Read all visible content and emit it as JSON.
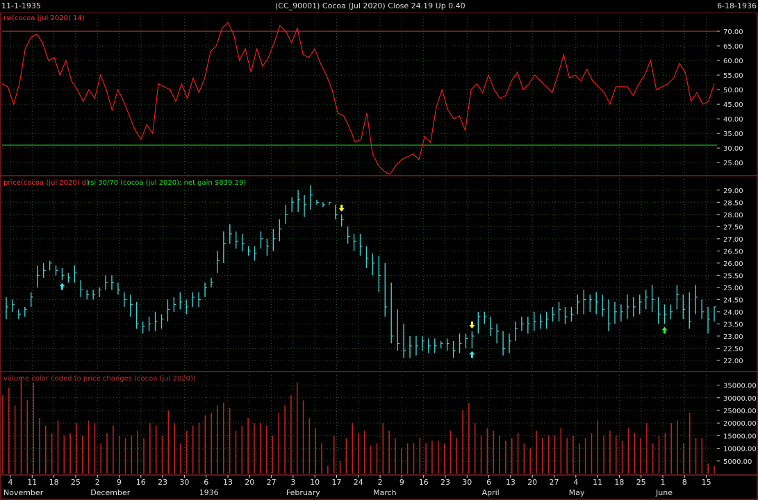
{
  "header": {
    "start_date": "11-1-1935",
    "title": "(CC_90001)  Cocoa (Jul 2020)   Close 24.19   Up 0.40",
    "end_date": "6-18-1936"
  },
  "colors": {
    "rsi": "#ff2020",
    "price": "#40d0d0",
    "volume": "#c02020",
    "grid": "#2e5a2e",
    "border": "#c03030",
    "level70": "#e04040",
    "level30": "#20e020",
    "buy": "#40e0e0",
    "sell": "#ffff20",
    "green_arrow": "#20ff20"
  },
  "chart_data": [
    {
      "type": "line",
      "title": "rsi(cocoa (jul 2020) 14)",
      "ylim": [
        21,
        75
      ],
      "yticks": [
        "70.00",
        "65.00",
        "60.00",
        "55.00",
        "50.00",
        "45.00",
        "40.00",
        "35.00",
        "30.00",
        "25.00"
      ],
      "yticks_values": [
        70,
        65,
        60,
        55,
        50,
        45,
        40,
        35,
        30,
        25
      ],
      "levels": [
        70,
        31
      ],
      "values": [
        52,
        51,
        45,
        52,
        64,
        68,
        69,
        66,
        60,
        61,
        55,
        60,
        53,
        50,
        46,
        50,
        47,
        55,
        50,
        43,
        50,
        46,
        41,
        36,
        33,
        38,
        35,
        52,
        51,
        50,
        46,
        52,
        47,
        54,
        49,
        54,
        63,
        65,
        71,
        73,
        69,
        60,
        64,
        56,
        64,
        58,
        61,
        66,
        72,
        70,
        66,
        71,
        62,
        61,
        64,
        59,
        55,
        50,
        42,
        41,
        37,
        32,
        33,
        42,
        28,
        24,
        22,
        21,
        24,
        26,
        27,
        28,
        26,
        34,
        32,
        44,
        50,
        43,
        40,
        41,
        36,
        50,
        52,
        49,
        55,
        50,
        47,
        48,
        53,
        56,
        50,
        52,
        55,
        53,
        51,
        49,
        55,
        62,
        54,
        55,
        53,
        57,
        53,
        51,
        49,
        45,
        51,
        51,
        51,
        48,
        52,
        55,
        60,
        50,
        51,
        52,
        54,
        59,
        56,
        46,
        49,
        45,
        46,
        52
      ],
      "xaxis": "shared"
    },
    {
      "type": "bar",
      "subtype": "ohlc",
      "title": "price(cocoa (jul 2020) d)",
      "subtitle": "rsi 30/70 (cocoa (jul 2020): net gain $839.29)",
      "ylim": [
        21.6,
        29.45
      ],
      "yticks": [
        "29.00",
        "28.50",
        "28.00",
        "27.50",
        "27.00",
        "26.50",
        "26.00",
        "25.50",
        "25.00",
        "24.50",
        "24.00",
        "23.50",
        "23.00",
        "22.50",
        "22.00"
      ],
      "yticks_values": [
        29,
        28.5,
        28,
        27.5,
        27,
        26.5,
        26,
        25.5,
        25,
        24.5,
        24,
        23.5,
        23,
        22.5,
        22
      ],
      "highs": [
        24.6,
        24.5,
        24.1,
        24.2,
        24.8,
        25.9,
        26.0,
        26.1,
        25.9,
        25.8,
        25.6,
        25.9,
        25.3,
        24.9,
        24.9,
        25.0,
        25.5,
        25.5,
        25.2,
        24.8,
        24.7,
        24.4,
        23.6,
        23.8,
        24.0,
        23.9,
        24.5,
        24.6,
        24.8,
        24.5,
        24.8,
        24.8,
        25.2,
        25.4,
        26.5,
        27.3,
        27.6,
        27.3,
        27.2,
        26.7,
        26.7,
        27.3,
        27.0,
        27.4,
        27.8,
        28.4,
        28.7,
        29.0,
        28.8,
        29.2,
        28.6,
        28.5,
        28.5,
        28.4,
        28.0,
        27.5,
        27.2,
        27.2,
        26.7,
        26.4,
        26.3,
        26.0,
        25.2,
        24.1,
        23.5,
        23.0,
        23.0,
        23.0,
        22.9,
        22.9,
        22.8,
        22.9,
        22.8,
        23.1,
        23.1,
        23.2,
        24.0,
        24.0,
        23.8,
        23.5,
        23.2,
        23.1,
        23.6,
        23.8,
        23.8,
        24.0,
        23.9,
        24.0,
        24.2,
        24.4,
        24.2,
        24.2,
        24.7,
        24.9,
        24.7,
        24.8,
        24.7,
        24.5,
        24.4,
        24.3,
        24.7,
        24.6,
        24.7,
        24.9,
        25.1,
        24.6,
        24.3,
        24.3,
        25.1,
        24.7,
        24.8,
        25.1,
        24.5,
        24.2,
        24.2
      ],
      "lows": [
        23.7,
        24.0,
        23.7,
        23.8,
        24.2,
        25.0,
        25.4,
        25.7,
        25.5,
        25.3,
        25.2,
        25.2,
        24.6,
        24.5,
        24.5,
        24.6,
        24.9,
        24.9,
        24.7,
        24.2,
        23.8,
        23.3,
        23.1,
        23.2,
        23.2,
        23.3,
        23.6,
        24.0,
        24.1,
        23.9,
        24.2,
        24.2,
        24.6,
        25.0,
        25.6,
        26.0,
        26.8,
        26.6,
        26.5,
        26.3,
        26.1,
        26.6,
        26.3,
        26.5,
        26.9,
        27.6,
        28.1,
        28.1,
        27.9,
        28.2,
        28.4,
        28.3,
        28.4,
        27.8,
        27.5,
        26.8,
        26.5,
        26.3,
        25.8,
        25.5,
        24.8,
        23.8,
        22.7,
        22.4,
        22.1,
        22.1,
        22.2,
        22.4,
        22.3,
        22.3,
        22.5,
        22.4,
        22.1,
        22.3,
        22.5,
        22.5,
        23.1,
        23.5,
        23.0,
        22.7,
        22.2,
        22.3,
        22.8,
        23.2,
        23.1,
        23.2,
        23.3,
        23.3,
        23.6,
        23.6,
        23.5,
        23.6,
        23.9,
        23.9,
        24.0,
        23.9,
        23.8,
        23.2,
        23.5,
        23.6,
        23.7,
        23.8,
        23.9,
        24.1,
        24.0,
        23.5,
        23.5,
        23.7,
        24.1,
        23.7,
        23.3,
        23.9,
        23.7,
        23.1,
        23.6
      ],
      "closes": [
        24.2,
        24.3,
        23.9,
        24.1,
        24.6,
        25.5,
        25.7,
        26.0,
        25.7,
        25.5,
        25.4,
        25.6,
        24.9,
        24.7,
        24.7,
        24.9,
        25.2,
        25.2,
        24.9,
        24.5,
        24.3,
        23.5,
        23.4,
        23.5,
        23.6,
        23.7,
        24.1,
        24.3,
        24.4,
        24.2,
        24.6,
        24.5,
        25.0,
        25.2,
        26.1,
        26.8,
        27.2,
        26.9,
        26.8,
        26.5,
        26.4,
        27.0,
        26.7,
        27.0,
        27.4,
        28.0,
        28.5,
        28.6,
        28.4,
        28.8,
        28.5,
        28.4,
        28.5,
        28.0,
        27.8,
        27.1,
        26.9,
        26.7,
        26.2,
        26.0,
        25.5,
        24.2,
        23.0,
        22.7,
        22.4,
        22.6,
        22.6,
        22.8,
        22.6,
        22.6,
        22.7,
        22.7,
        22.4,
        22.7,
        22.9,
        23.0,
        23.8,
        23.8,
        23.3,
        23.2,
        22.5,
        22.8,
        23.3,
        23.5,
        23.5,
        23.6,
        23.6,
        23.7,
        23.9,
        24.1,
        23.8,
        23.9,
        24.4,
        24.5,
        24.5,
        24.4,
        24.1,
        23.5,
        24.0,
        24.0,
        24.2,
        24.2,
        24.4,
        24.6,
        24.5,
        23.9,
        23.9,
        24.0,
        24.7,
        24.1,
        23.6,
        24.6,
        24.0,
        23.7,
        24.2
      ],
      "signals": [
        {
          "type": "buy",
          "index": 9
        },
        {
          "type": "sell",
          "index": 54
        },
        {
          "type": "sell",
          "index": 75
        },
        {
          "type": "buy",
          "index": 75
        },
        {
          "type": "buy",
          "index": 106
        }
      ],
      "xaxis": "shared"
    },
    {
      "type": "bar",
      "title": "volume color coded to price changes (cocoa (jul 2020))",
      "ylim": [
        0,
        39000
      ],
      "yticks": [
        "35000.00",
        "30000.00",
        "25000.00",
        "20000.00",
        "15000.00",
        "10000.00",
        "5000.00"
      ],
      "yticks_values": [
        35000,
        30000,
        25000,
        20000,
        15000,
        10000,
        5000
      ],
      "values": [
        31000,
        34000,
        27000,
        38000,
        29000,
        36000,
        22000,
        19000,
        16000,
        21000,
        15000,
        16000,
        20000,
        15000,
        21000,
        20000,
        12000,
        16000,
        19000,
        15000,
        14000,
        15000,
        17000,
        14000,
        20000,
        19000,
        15000,
        25000,
        20000,
        12000,
        17000,
        19000,
        20000,
        23000,
        24000,
        27000,
        28000,
        26000,
        17000,
        19000,
        22000,
        20000,
        20000,
        19000,
        15000,
        24000,
        27000,
        31000,
        36000,
        29000,
        22000,
        18000,
        12000,
        3000,
        15000,
        5000,
        14000,
        20000,
        16000,
        17000,
        11000,
        12000,
        20000,
        17000,
        14000,
        10000,
        12000,
        12000,
        14000,
        12000,
        13000,
        13000,
        12000,
        17000,
        14000,
        25000,
        28000,
        20000,
        15000,
        18000,
        17000,
        15000,
        13000,
        14000,
        16000,
        12000,
        10000,
        17000,
        14000,
        15000,
        15000,
        18000,
        14000,
        15000,
        12000,
        14000,
        16000,
        21000,
        15000,
        17000,
        15000,
        13000,
        18000,
        16000,
        14000,
        20000,
        12000,
        15000,
        16000,
        20000,
        21000,
        12000,
        24000,
        14000,
        14000,
        4000,
        3000
      ],
      "xaxis": "shared"
    }
  ],
  "xaxis": {
    "day_labels": [
      "4",
      "11",
      "18",
      "25",
      "2",
      "9",
      "16",
      "23",
      "30",
      "6",
      "13",
      "20",
      "27",
      "3",
      "10",
      "17",
      "24",
      "2",
      "9",
      "16",
      "23",
      "30",
      "6",
      "13",
      "20",
      "27",
      "4",
      "11",
      "18",
      "25",
      "1",
      "8",
      "15"
    ],
    "month_labels": [
      {
        "label": "November",
        "tick": 0
      },
      {
        "label": "December",
        "tick": 4
      },
      {
        "label": "1936",
        "tick": 9
      },
      {
        "label": "February",
        "tick": 13
      },
      {
        "label": "March",
        "tick": 17
      },
      {
        "label": "April",
        "tick": 22
      },
      {
        "label": "May",
        "tick": 26
      },
      {
        "label": "June",
        "tick": 30
      }
    ]
  }
}
